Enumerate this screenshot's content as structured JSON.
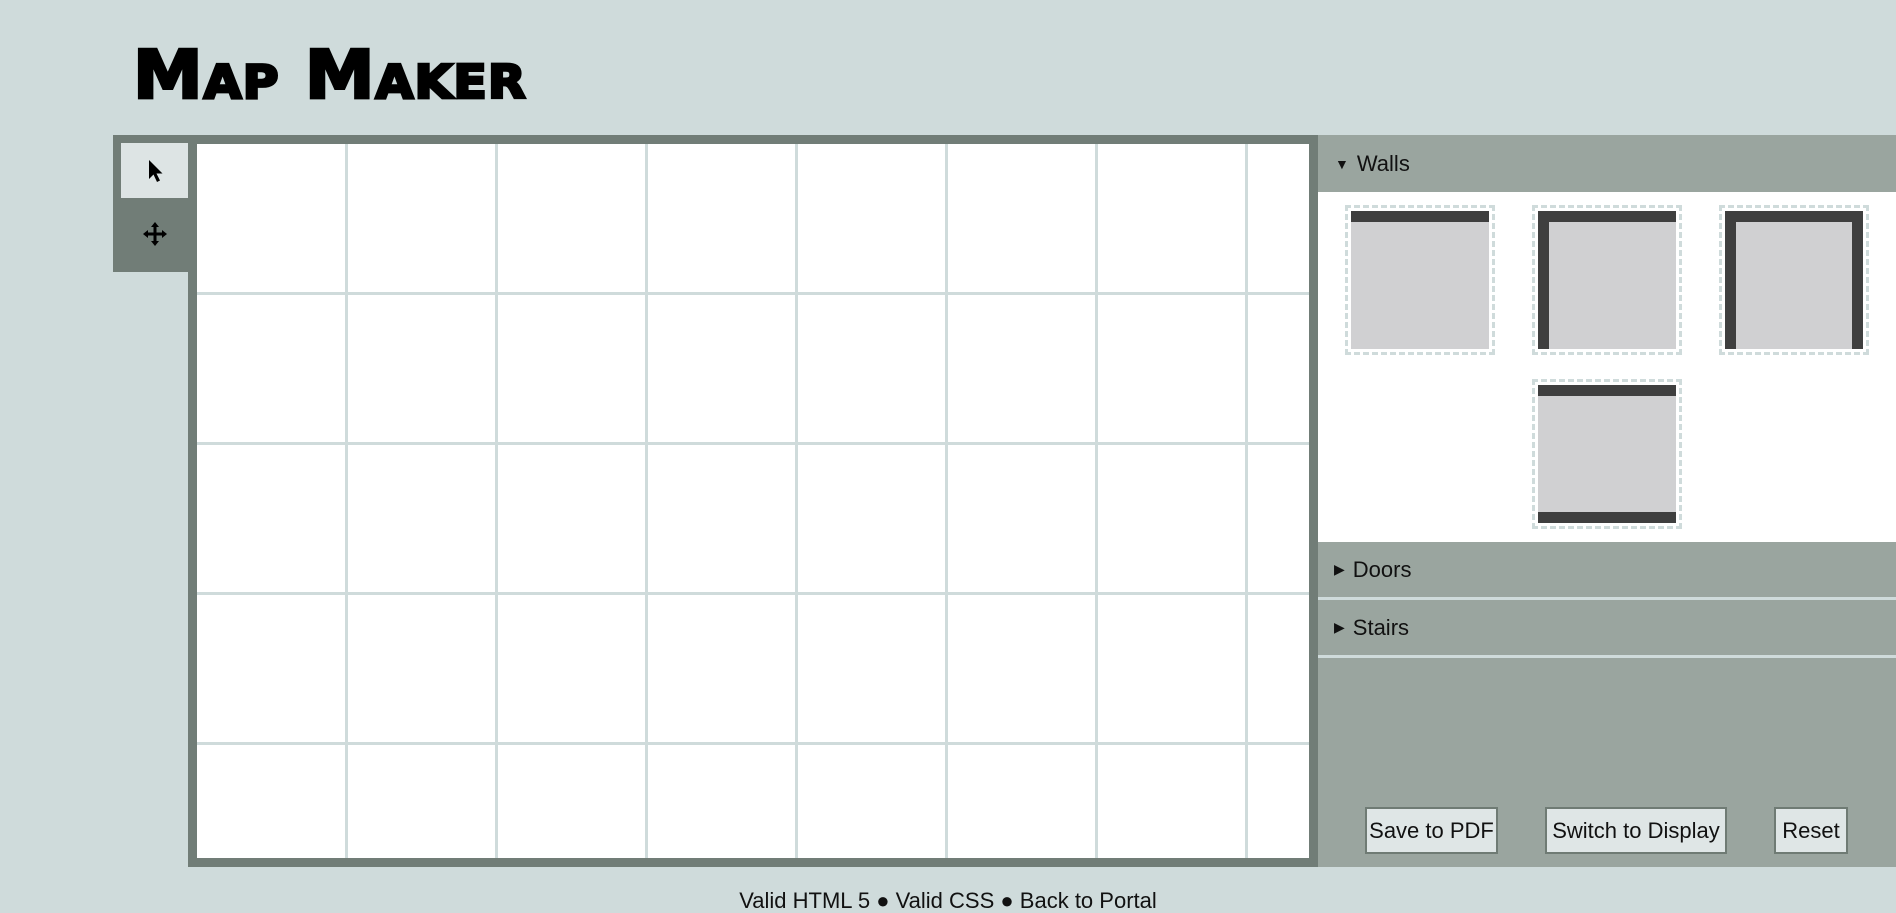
{
  "app": {
    "title": "Map Maker"
  },
  "toolbox": {
    "tools": [
      {
        "name": "select",
        "icon": "pointer-arrow-icon",
        "active": true
      },
      {
        "name": "move",
        "icon": "move-arrows-icon",
        "active": false
      }
    ]
  },
  "grid": {
    "columns": 8,
    "rows": 5
  },
  "sidebar": {
    "sections": [
      {
        "label": "Walls",
        "expanded": true,
        "caret": "▼"
      },
      {
        "label": "Doors",
        "expanded": false,
        "caret": "▶"
      },
      {
        "label": "Stairs",
        "expanded": false,
        "caret": "▶"
      }
    ],
    "wall_tiles": [
      {
        "name": "wall-top",
        "sides": [
          "top"
        ]
      },
      {
        "name": "wall-top-left-right",
        "sides": [
          "top",
          "left"
        ]
      },
      {
        "name": "wall-top-left-right-both",
        "sides": [
          "top",
          "left",
          "right"
        ]
      },
      {
        "name": "wall-top-bottom",
        "sides": [
          "top",
          "bottom"
        ]
      }
    ]
  },
  "actions": {
    "save_pdf": "Save to PDF",
    "switch_display": "Switch to Display",
    "reset": "Reset"
  },
  "footer": {
    "valid_html": "Valid HTML 5",
    "sep1": "●",
    "valid_css": "Valid CSS",
    "sep2": "●",
    "portal": "Back to Portal"
  },
  "colors": {
    "page_bg": "#cfdbdb",
    "frame": "#717d77",
    "sidebar": "#9aa59f",
    "wall": "#3f3f3f",
    "tile": "#d0d0d2"
  }
}
